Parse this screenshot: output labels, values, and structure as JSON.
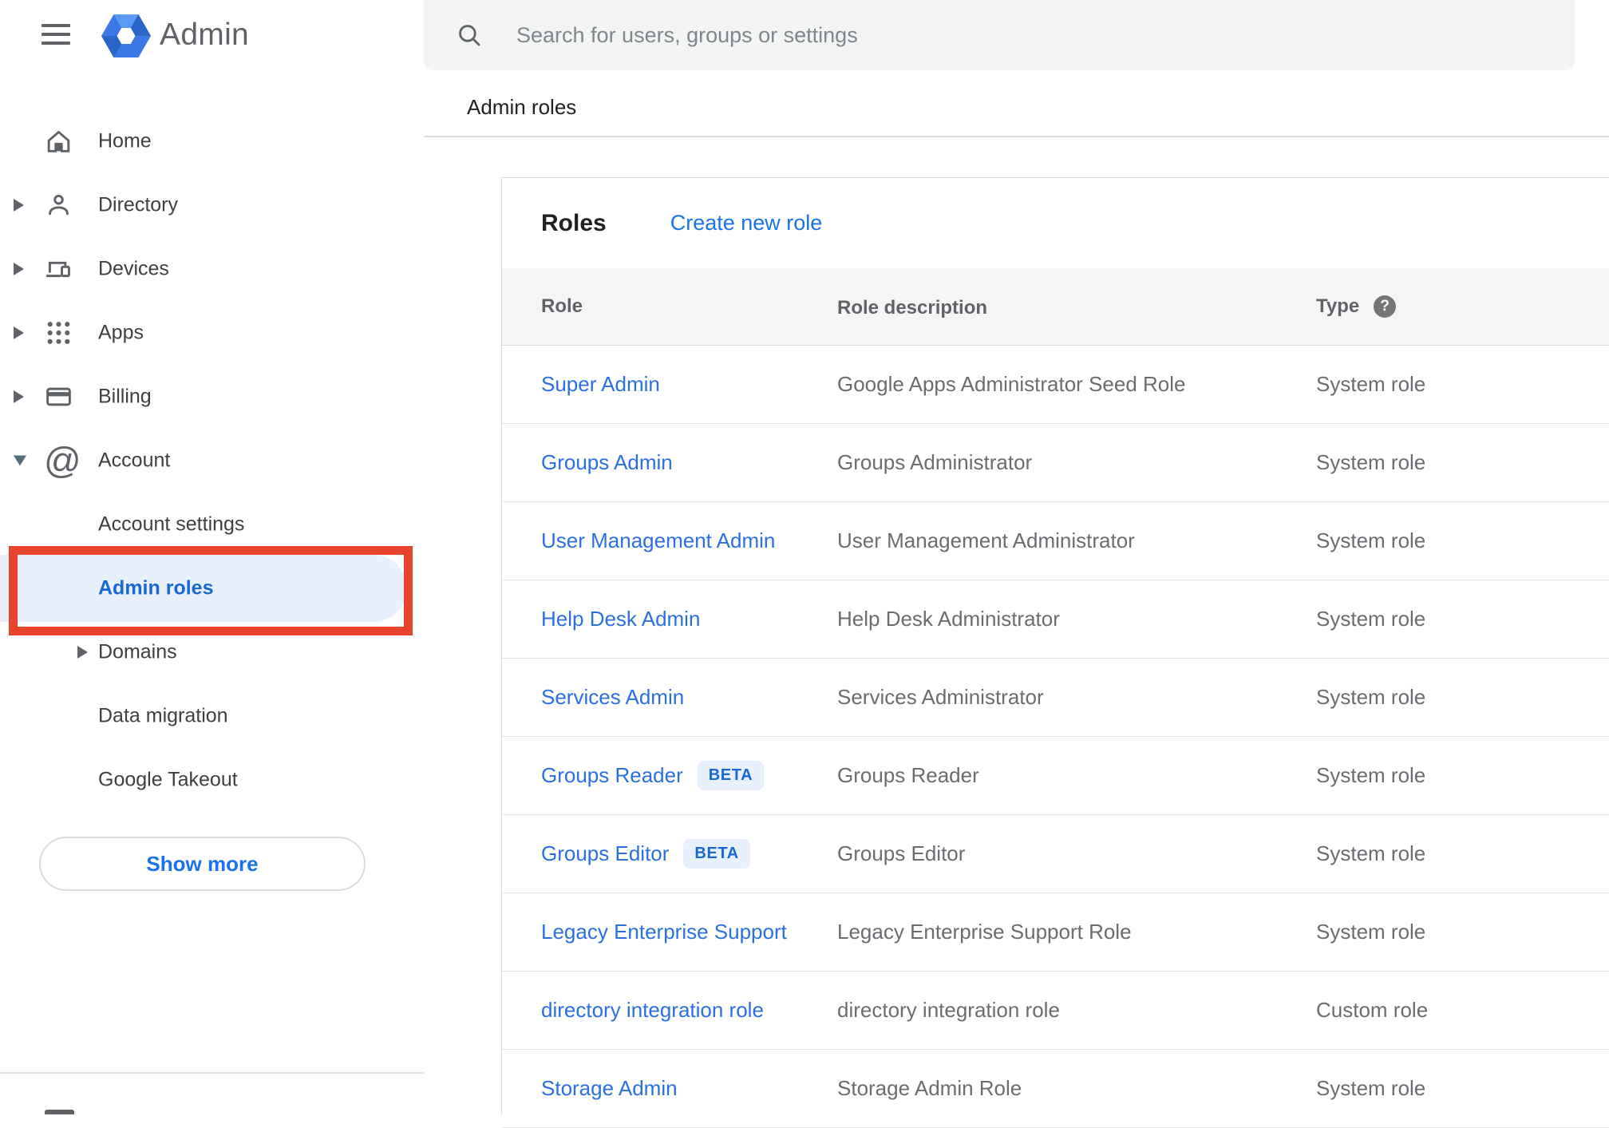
{
  "sidebar": {
    "logo_text": "Admin",
    "items": [
      {
        "label": "Home",
        "icon": "home"
      },
      {
        "label": "Directory",
        "icon": "person",
        "arrow": "right"
      },
      {
        "label": "Devices",
        "icon": "devices",
        "arrow": "right"
      },
      {
        "label": "Apps",
        "icon": "apps",
        "arrow": "right"
      },
      {
        "label": "Billing",
        "icon": "credit-card",
        "arrow": "right"
      },
      {
        "label": "Account",
        "icon": "at-sign",
        "arrow": "down"
      },
      {
        "label": "Account settings",
        "sub": true
      },
      {
        "label": "Admin roles",
        "sub": true,
        "active": true
      },
      {
        "label": "Domains",
        "sub": true,
        "arrow": "right"
      },
      {
        "label": "Data migration",
        "sub": true
      },
      {
        "label": "Google Takeout",
        "sub": true
      }
    ],
    "show_more_label": "Show more"
  },
  "search": {
    "placeholder": "Search for users, groups or settings"
  },
  "breadcrumb": "Admin roles",
  "roles_card": {
    "title": "Roles",
    "create_link_label": "Create new role",
    "columns": {
      "role": "Role",
      "description": "Role description",
      "type": "Type"
    },
    "help_icon_glyph": "?",
    "beta_label": "BETA",
    "rows": [
      {
        "role": "Super Admin",
        "beta": false,
        "description": "Google Apps Administrator Seed Role",
        "type": "System role"
      },
      {
        "role": "Groups Admin",
        "beta": false,
        "description": "Groups Administrator",
        "type": "System role"
      },
      {
        "role": "User Management Admin",
        "beta": false,
        "description": "User Management Administrator",
        "type": "System role"
      },
      {
        "role": "Help Desk Admin",
        "beta": false,
        "description": "Help Desk Administrator",
        "type": "System role"
      },
      {
        "role": "Services Admin",
        "beta": false,
        "description": "Services Administrator",
        "type": "System role"
      },
      {
        "role": "Groups Reader",
        "beta": true,
        "description": "Groups Reader",
        "type": "System role"
      },
      {
        "role": "Groups Editor",
        "beta": true,
        "description": "Groups Editor",
        "type": "System role"
      },
      {
        "role": "Legacy Enterprise Support",
        "beta": false,
        "description": "Legacy Enterprise Support Role",
        "type": "System role"
      },
      {
        "role": "directory integration role",
        "beta": false,
        "description": "directory integration role",
        "type": "Custom role"
      },
      {
        "role": "Storage Admin",
        "beta": false,
        "description": "Storage Admin Role",
        "type": "System role"
      }
    ]
  },
  "colors": {
    "accent_blue": "#1a73e8",
    "active_item_blue": "#1967d2",
    "highlight_pill_bg": "#e8f0fe",
    "beta_badge_bg": "#e8f0fe",
    "beta_badge_text": "#1967d2",
    "annotation_box_red": "#e8432c",
    "table_header_bg": "#f5f5f6",
    "search_bar_bg": "#f3f4f4"
  }
}
